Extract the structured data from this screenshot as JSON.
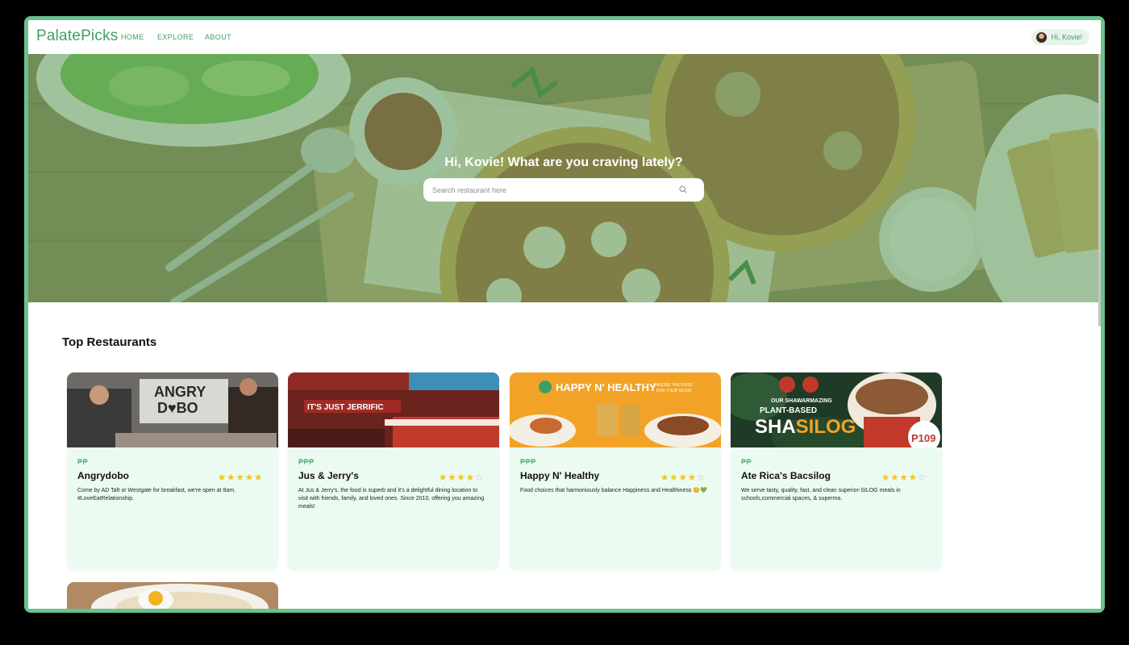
{
  "header": {
    "logo": "PalatePicks",
    "nav": [
      "HOME",
      "EXPLORE",
      "ABOUT"
    ],
    "user_greeting": "Hi, Kovie!"
  },
  "hero": {
    "title": "Hi, Kovie! What are you craving lately?",
    "search_placeholder": "Search restaurant here"
  },
  "section_title": "Top Restaurants",
  "restaurants": [
    {
      "name": "Angrydobo",
      "price": "₱₱",
      "rating": 5,
      "stars": "★★★★★",
      "star_empty": "",
      "image_text": "ANGRY DOBO",
      "description": "Come by AD Taft or Westgate for breakfast, we're open at 8am. #LoveEatRelationship."
    },
    {
      "name": "Jus & Jerry's",
      "price": "₱₱₱",
      "rating": 4,
      "stars": "★★★★",
      "star_empty": "☆",
      "image_text": "IT'S JUST JERRIFIC",
      "description": "At Jus & Jerry's, the food is superb and it's a delightful dining location to visit with friends, family, and loved ones. Since 2010, offering you amazing meals!"
    },
    {
      "name": "Happy N' Healthy",
      "price": "₱₱₱",
      "rating": 4,
      "stars": "★★★★",
      "star_empty": "☆",
      "image_text": "HAPPY N' HEALTHY",
      "image_subtext": "CHOOSE THE FOOD FOR YOUR MOOD",
      "description": "Food choices that harmoniously balance Happiness and Healthiness 😊💚"
    },
    {
      "name": "Ate Rica's Bacsilog",
      "price": "₱₱",
      "rating": 4,
      "stars": "★★★★",
      "star_empty": "☆",
      "image_text": "SHASILOG",
      "image_subtext": "OUR SHAWARMAZING PLANT-BASED",
      "image_price": "P109",
      "description": "We serve tasty, quality, fast, and clean superior-SILOG meals in schools,commercial spaces, & superma."
    }
  ],
  "colors": {
    "brand": "#3f9f62",
    "frame": "#69c28d",
    "card_bg": "#ecfbf2",
    "star": "#f3c71d"
  }
}
